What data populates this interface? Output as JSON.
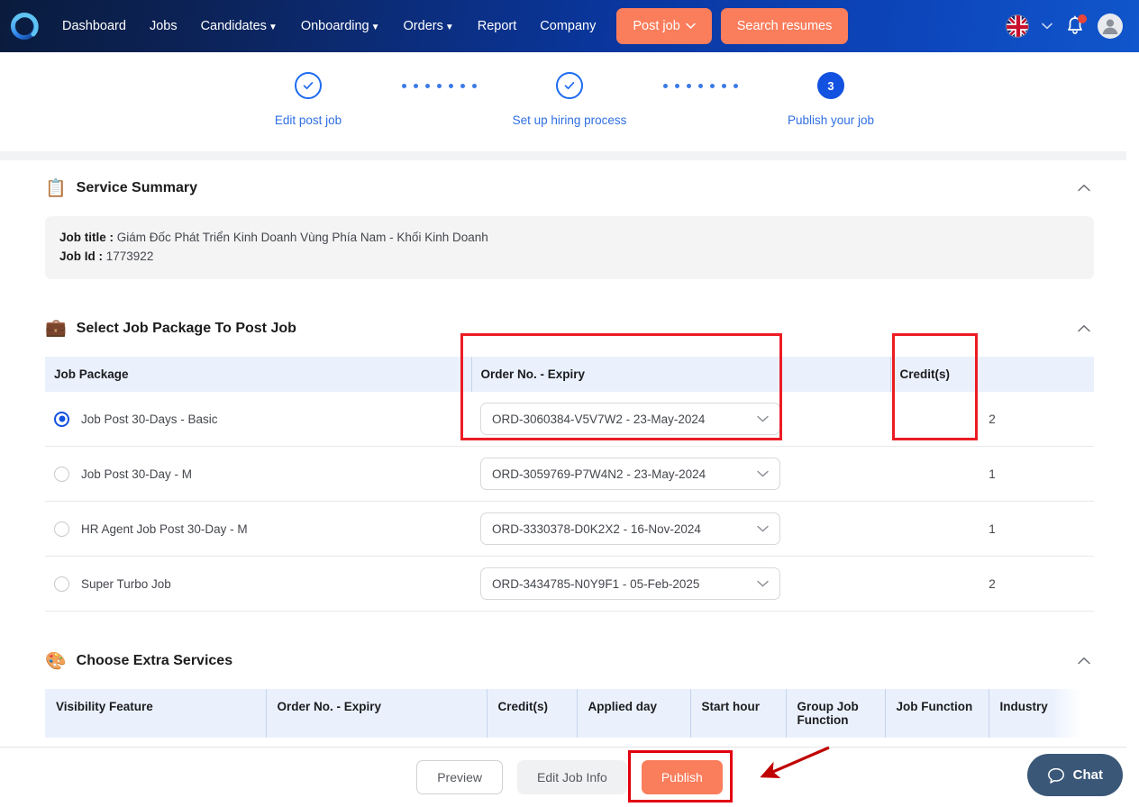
{
  "navbar": {
    "logo_name": "company-logo",
    "links": [
      {
        "label": "Dashboard",
        "has_caret": false
      },
      {
        "label": "Jobs",
        "has_caret": false
      },
      {
        "label": "Candidates",
        "has_caret": true
      },
      {
        "label": "Onboarding",
        "has_caret": true
      },
      {
        "label": "Orders",
        "has_caret": true
      },
      {
        "label": "Report",
        "has_caret": false
      },
      {
        "label": "Company",
        "has_caret": false
      }
    ],
    "post_job_label": "Post job",
    "post_job_caret": "⌄",
    "search_resumes_label": "Search resumes",
    "language_flag": "uk-flag-icon",
    "language_caret": "⌄",
    "notification_icon": "bell-icon",
    "has_notification": true,
    "avatar_icon": "user-avatar-icon",
    "accent_color": "#fa7d5c",
    "gradient_from": "#0a1b3d",
    "gradient_to": "#1156cc"
  },
  "stepper": {
    "accent_color": "#1e6bf0",
    "steps": [
      {
        "label": "Edit post job",
        "state": "done",
        "marker": "✓"
      },
      {
        "label": "Set up hiring process",
        "state": "done",
        "marker": "✓"
      },
      {
        "label": "Publish your job",
        "state": "current",
        "marker": "3"
      }
    ]
  },
  "service_summary": {
    "icon": "document-icon",
    "title": "Service Summary",
    "collapse_icon": "chevron-up-icon",
    "job_title_label": "Job title :",
    "job_title_value": "Giám Đốc Phát Triển Kinh Doanh Vùng Phía Nam - Khối Kinh Doanh",
    "job_id_label": "Job Id :",
    "job_id_value": "1773922"
  },
  "job_package": {
    "icon": "briefcase-icon",
    "title": "Select Job Package To Post Job",
    "collapse_icon": "chevron-up-icon",
    "columns": [
      "Job Package",
      "Order No. - Expiry",
      "Credit(s)"
    ],
    "rows": [
      {
        "package": "Job Post 30-Days - Basic",
        "order": "ORD-3060384-V5V7W2 - 23-May-2024",
        "credits": "2",
        "selected": true
      },
      {
        "package": "Job Post 30-Day - M",
        "order": "ORD-3059769-P7W4N2 - 23-May-2024",
        "credits": "1",
        "selected": false
      },
      {
        "package": "HR Agent Job Post 30-Day - M",
        "order": "ORD-3330378-D0K2X2 - 16-Nov-2024",
        "credits": "1",
        "selected": false
      },
      {
        "package": "Super Turbo Job",
        "order": "ORD-3434785-N0Y9F1 - 05-Feb-2025",
        "credits": "2",
        "selected": false
      }
    ],
    "select_caret": "⌄"
  },
  "extra_services": {
    "icon": "palette-icon",
    "title": "Choose Extra Services",
    "collapse_icon": "chevron-up-icon",
    "columns": [
      "Visibility Feature",
      "Order No. - Expiry",
      "Credit(s)",
      "Applied day",
      "Start hour",
      "Group Job Function",
      "Job Function",
      "Industry"
    ]
  },
  "footer": {
    "preview_label": "Preview",
    "edit_label": "Edit Job Info",
    "publish_label": "Publish",
    "chat_label": "Chat",
    "chat_icon": "chat-bubble-icon"
  },
  "annotations": {
    "box_color": "#ec1c24",
    "arrow_color": "#c00000",
    "highlight_order_column": true,
    "highlight_credit_column": true,
    "highlight_publish_button": true
  }
}
